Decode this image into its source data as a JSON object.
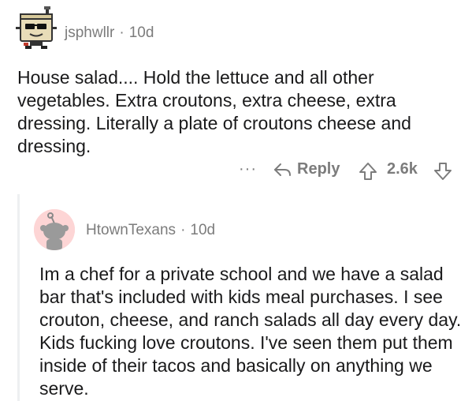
{
  "comment": {
    "username": "jsphwllr",
    "separator": "·",
    "age": "10d",
    "body": "House salad.... Hold the lettuce and all other vegetables. Extra croutons, extra cheese, extra dressing. Literally a plate of croutons cheese and dressing.",
    "actions": {
      "more": "···",
      "reply_label": "Reply",
      "score": "2.6k"
    }
  },
  "reply": {
    "username": "HtownTexans",
    "separator": "·",
    "age": "10d",
    "body": "Im a chef for a private school and we have a salad bar that's included with kids meal purchases.  I see crouton, cheese, and ranch salads all day every day.  Kids fucking love croutons.  I've seen them put them inside of their tacos and basically on anything we serve."
  },
  "icons": {
    "reply": "reply-arrow-icon",
    "upvote": "upvote-arrow-icon",
    "downvote": "downvote-arrow-icon",
    "avatar_top": "computer-robot-avatar-icon",
    "avatar_reply": "default-snoo-avatar-icon"
  },
  "colors": {
    "meta_text": "#7c7c7c",
    "body_text": "#1a1a1b",
    "reply_avatar_bg": "#fdd5d5",
    "thread_line": "#edeff1"
  }
}
